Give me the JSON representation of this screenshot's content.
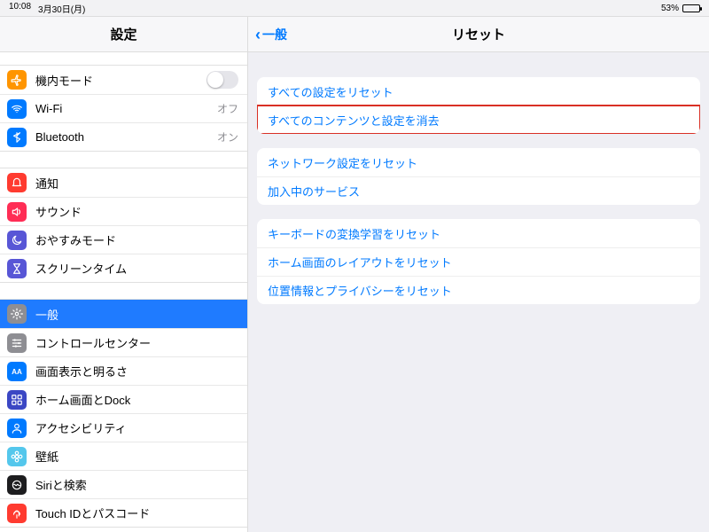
{
  "status": {
    "time": "10:08",
    "date": "3月30日(月)",
    "battery": "53%"
  },
  "sidebar": {
    "title": "設定",
    "groups": [
      {
        "rows": [
          {
            "id": "airplane",
            "label": "機内モード",
            "icon_bg": "#ff9500",
            "glyph": "airplane",
            "toggle": true
          },
          {
            "id": "wifi",
            "label": "Wi-Fi",
            "icon_bg": "#007aff",
            "glyph": "wifi",
            "value": "オフ"
          },
          {
            "id": "bluetooth",
            "label": "Bluetooth",
            "icon_bg": "#007aff",
            "glyph": "bluetooth",
            "value": "オン"
          }
        ]
      },
      {
        "rows": [
          {
            "id": "notifications",
            "label": "通知",
            "icon_bg": "#ff3b30",
            "glyph": "bell"
          },
          {
            "id": "sounds",
            "label": "サウンド",
            "icon_bg": "#ff2d55",
            "glyph": "speaker"
          },
          {
            "id": "dnd",
            "label": "おやすみモード",
            "icon_bg": "#5856d6",
            "glyph": "moon"
          },
          {
            "id": "screentime",
            "label": "スクリーンタイム",
            "icon_bg": "#5856d6",
            "glyph": "hourglass"
          }
        ]
      },
      {
        "rows": [
          {
            "id": "general",
            "label": "一般",
            "icon_bg": "#8e8e93",
            "glyph": "gear",
            "selected": true
          },
          {
            "id": "controlcenter",
            "label": "コントロールセンター",
            "icon_bg": "#8e8e93",
            "glyph": "sliders"
          },
          {
            "id": "display",
            "label": "画面表示と明るさ",
            "icon_bg": "#007aff",
            "glyph": "aa"
          },
          {
            "id": "home",
            "label": "ホーム画面とDock",
            "icon_bg": "#3b47c4",
            "glyph": "grid"
          },
          {
            "id": "accessibility",
            "label": "アクセシビリティ",
            "icon_bg": "#007aff",
            "glyph": "person"
          },
          {
            "id": "wallpaper",
            "label": "壁紙",
            "icon_bg": "#54c7ec",
            "glyph": "flower"
          },
          {
            "id": "siri",
            "label": "Siriと検索",
            "icon_bg": "#1d1d1f",
            "glyph": "siri"
          },
          {
            "id": "touchid",
            "label": "Touch IDとパスコード",
            "icon_bg": "#ff3b30",
            "glyph": "finger"
          }
        ]
      }
    ]
  },
  "detail": {
    "back_label": "一般",
    "title": "リセット",
    "groups": [
      [
        {
          "id": "reset-all-settings",
          "label": "すべての設定をリセット"
        },
        {
          "id": "erase-all",
          "label": "すべてのコンテンツと設定を消去",
          "highlight": true
        }
      ],
      [
        {
          "id": "reset-network",
          "label": "ネットワーク設定をリセット"
        },
        {
          "id": "subscribed-services",
          "label": "加入中のサービス"
        }
      ],
      [
        {
          "id": "reset-keyboard",
          "label": "キーボードの変換学習をリセット"
        },
        {
          "id": "reset-home",
          "label": "ホーム画面のレイアウトをリセット"
        },
        {
          "id": "reset-location",
          "label": "位置情報とプライバシーをリセット"
        }
      ]
    ]
  }
}
